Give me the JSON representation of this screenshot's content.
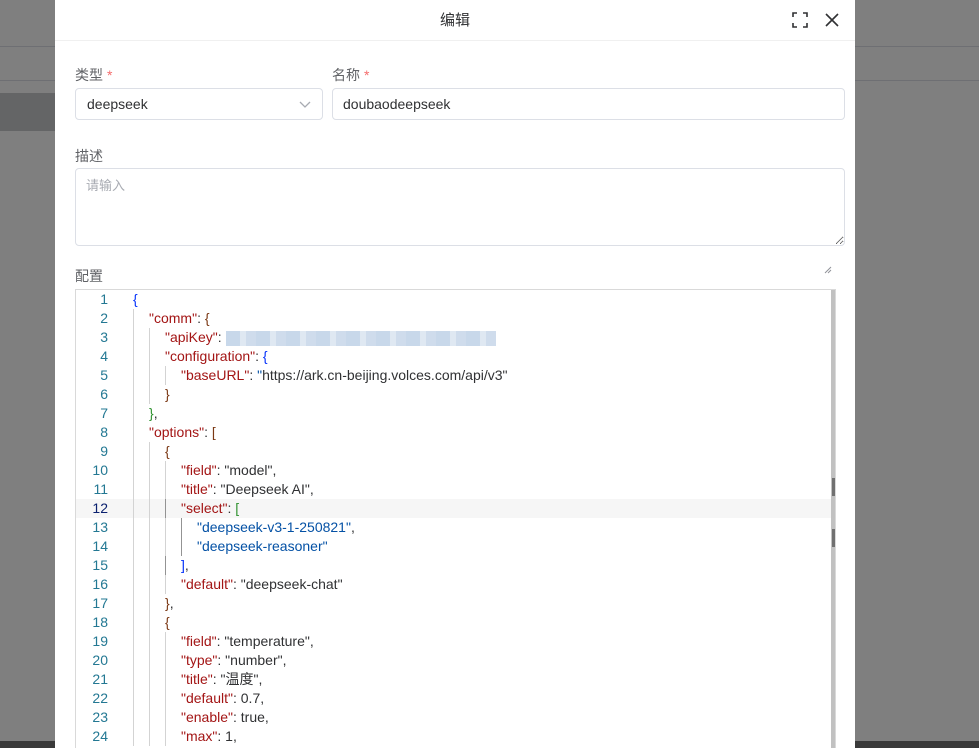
{
  "dialog": {
    "title": "编辑",
    "fields": {
      "type_label": "类型",
      "type_value": "deepseek",
      "name_label": "名称",
      "name_value": "doubaodeepseek",
      "required_mark": "*",
      "desc_label": "描述",
      "desc_placeholder": "请输入",
      "config_label": "配置"
    }
  },
  "icons": {
    "fullscreen": "fullscreen-icon",
    "close": "close-icon",
    "dropdown": "chevron-down-icon",
    "resize": "resize-handle-icon"
  },
  "editor": {
    "active_line": 12,
    "lines": [
      {
        "n": "1",
        "t": "{"
      },
      {
        "n": "2",
        "t": "\"comm\": {"
      },
      {
        "n": "3",
        "t": "\"apiKey\": "
      },
      {
        "n": "4",
        "t": "\"configuration\": {"
      },
      {
        "n": "5",
        "t": "\"baseURL\": \"https://ark.cn-beijing.volces.com/api/v3\""
      },
      {
        "n": "6",
        "t": "}"
      },
      {
        "n": "7",
        "t": "},"
      },
      {
        "n": "8",
        "t": "\"options\": ["
      },
      {
        "n": "9",
        "t": "{"
      },
      {
        "n": "10",
        "t": "\"field\": \"model\","
      },
      {
        "n": "11",
        "t": "\"title\": \"Deepseek AI\","
      },
      {
        "n": "12",
        "t": "\"select\": ["
      },
      {
        "n": "13",
        "t": "\"deepseek-v3-1-250821\","
      },
      {
        "n": "14",
        "t": "\"deepseek-reasoner\""
      },
      {
        "n": "15",
        "t": "],"
      },
      {
        "n": "16",
        "t": "\"default\": \"deepseek-chat\""
      },
      {
        "n": "17",
        "t": "},"
      },
      {
        "n": "18",
        "t": "{"
      },
      {
        "n": "19",
        "t": "\"field\": \"temperature\","
      },
      {
        "n": "20",
        "t": "\"type\": \"number\","
      },
      {
        "n": "21",
        "t": "\"title\": \"温度\","
      },
      {
        "n": "22",
        "t": "\"default\": 0.7,"
      },
      {
        "n": "23",
        "t": "\"enable\": true,"
      },
      {
        "n": "24",
        "t": "\"max\": 1,"
      }
    ]
  },
  "colors": {
    "key": "#a31515",
    "string": "#0451a5",
    "number": "#098658",
    "line_number": "#237893",
    "required": "#f56c6c"
  }
}
